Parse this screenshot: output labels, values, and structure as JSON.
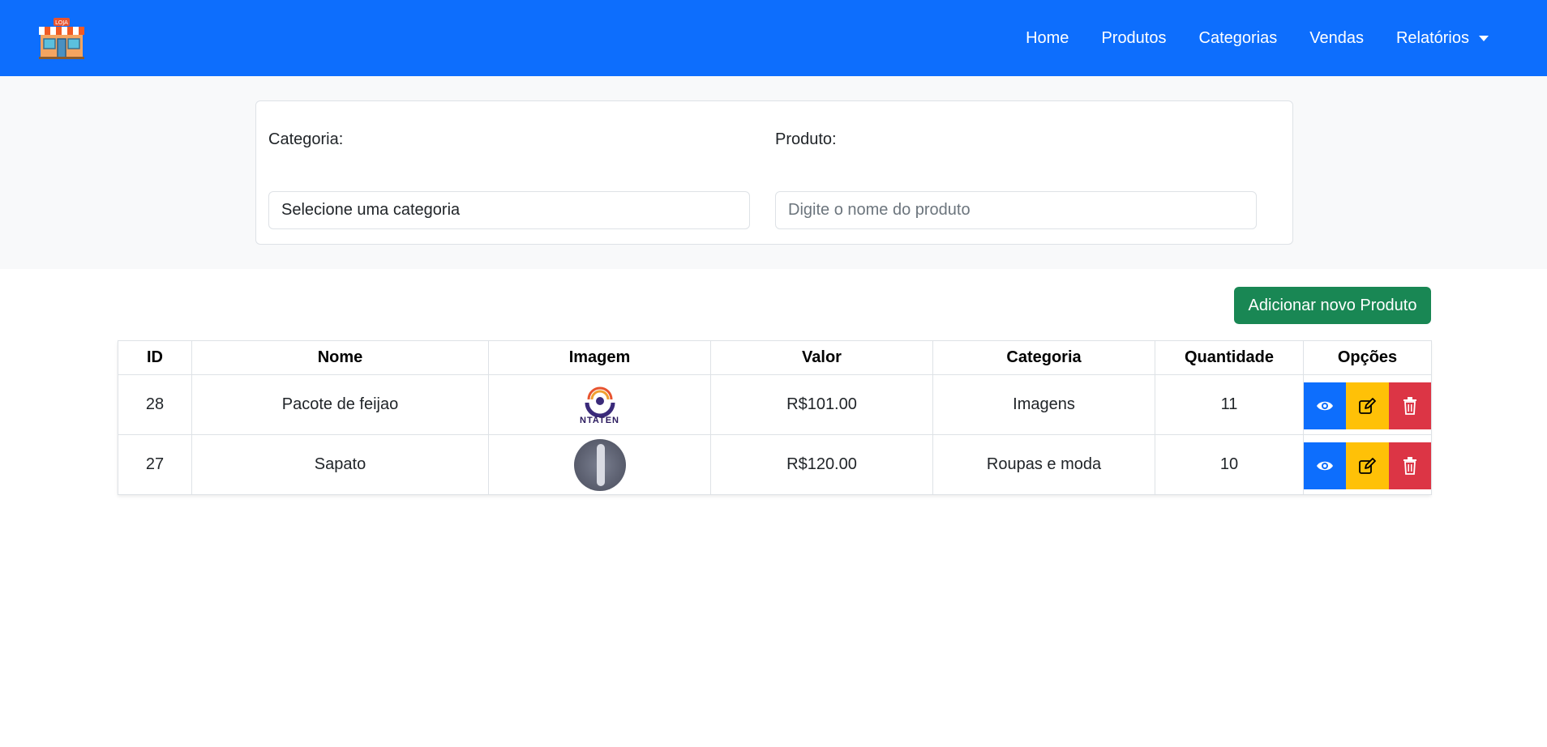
{
  "navbar": {
    "brand_icon": "store-icon",
    "brand_text": "LOJA",
    "links": [
      {
        "label": "Home"
      },
      {
        "label": "Produtos"
      },
      {
        "label": "Categorias"
      },
      {
        "label": "Vendas"
      },
      {
        "label": "Relatórios",
        "dropdown": true
      }
    ],
    "color": "#0d6efd"
  },
  "filters": {
    "category_label": "Categoria:",
    "category_selected": "Selecione uma categoria",
    "product_label": "Produto:",
    "product_placeholder": "Digite o nome do produto",
    "product_value": ""
  },
  "add_button": {
    "label": "Adicionar novo Produto",
    "color": "#198754"
  },
  "table": {
    "headers": [
      "ID",
      "Nome",
      "Imagem",
      "Valor",
      "Categoria",
      "Quantidade",
      "Opções"
    ],
    "rows": [
      {
        "id": "28",
        "nome": "Pacote de feijao",
        "imagem_text": "NTATEN",
        "valor": "R$101.00",
        "categoria": "Imagens",
        "quantidade": "11"
      },
      {
        "id": "27",
        "nome": "Sapato",
        "imagem_text": "",
        "valor": "R$120.00",
        "categoria": "Roupas e moda",
        "quantidade": "10"
      }
    ],
    "option_icons": [
      "eye-icon",
      "edit-icon",
      "trash-icon"
    ],
    "option_colors": {
      "view": "#0d6efd",
      "edit": "#ffc107",
      "delete": "#dc3545"
    }
  }
}
